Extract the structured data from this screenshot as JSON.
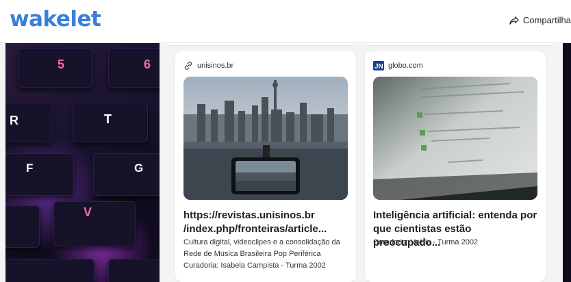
{
  "header": {
    "logo": "wakelet",
    "share_label": "Compartilha"
  },
  "hero": {
    "keys": [
      "5",
      "6",
      "R",
      "T",
      "F",
      "G",
      "V"
    ]
  },
  "cards": [
    {
      "source": "unisinos.br",
      "source_icon": "link-icon",
      "title": "https://revistas.unisinos.br /index.php/fronteiras/article...",
      "description": "Cultura digital, videoclipes e a consolidação da Rede de Música Brasileira Pop Periférica",
      "curator": "Curadoria: Isabela Campista - Turma 2002"
    },
    {
      "source": "globo.com",
      "source_icon": "globo-logo-icon",
      "title": "Inteligência artificial: entenda por que cientistas estão preocupado...",
      "description": "",
      "curator": "Curadoria: Vyétia - Turma 2002"
    }
  ],
  "colors": {
    "logo": "#3a7fd6",
    "background": "#f4f4f6"
  }
}
